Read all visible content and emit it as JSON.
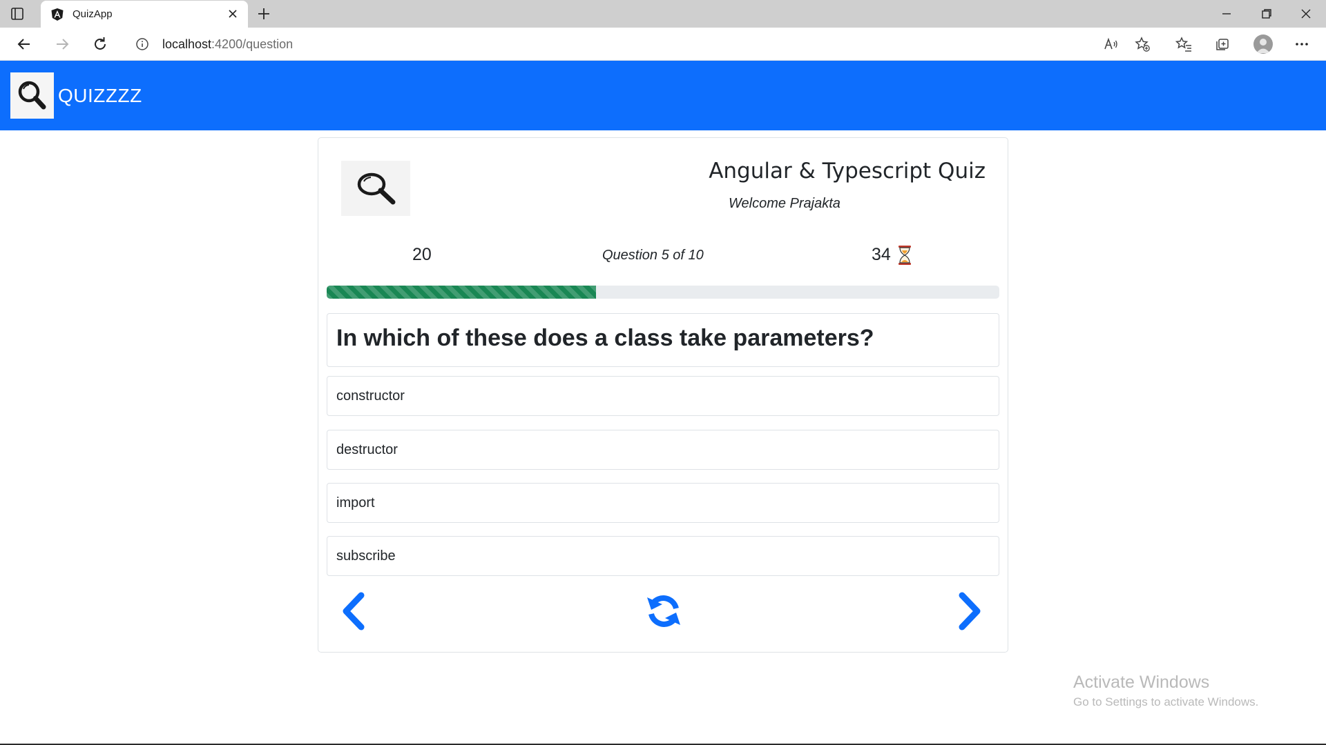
{
  "browser": {
    "tab_title": "QuizApp",
    "url_host": "localhost",
    "url_rest": ":4200/question",
    "icons": [
      "tab-actions-icon",
      "angular-favicon",
      "close-icon",
      "plus-icon",
      "minimize-icon",
      "restore-icon",
      "close-window-icon",
      "back-icon",
      "forward-icon",
      "refresh-icon",
      "info-icon",
      "read-aloud-icon",
      "add-favorite-icon",
      "favorites-icon",
      "collections-icon",
      "profile-avatar",
      "more-icon"
    ]
  },
  "navbar": {
    "brand": "QUIZZZZ",
    "logo_icon": "magnifier-icon",
    "color": "#0d6efd"
  },
  "quiz": {
    "title": "Angular & Typescript Quiz",
    "welcome": "Welcome Prajakta",
    "points": "20",
    "question_counter": "Question 5 of 10",
    "timer": "34",
    "timer_icon": "hourglass-icon",
    "progress_fraction": 0.4,
    "progress_color": "#198754",
    "question": "In which of these does a class take parameters?",
    "options": [
      "constructor",
      "destructor",
      "import",
      "subscribe"
    ],
    "controls": {
      "previous_icon": "chevron-left-icon",
      "reset_icon": "refresh-icon",
      "next_icon": "chevron-right-icon",
      "color": "#0d6efd"
    }
  },
  "watermark": {
    "title": "Activate Windows",
    "subtitle": "Go to Settings to activate Windows."
  }
}
